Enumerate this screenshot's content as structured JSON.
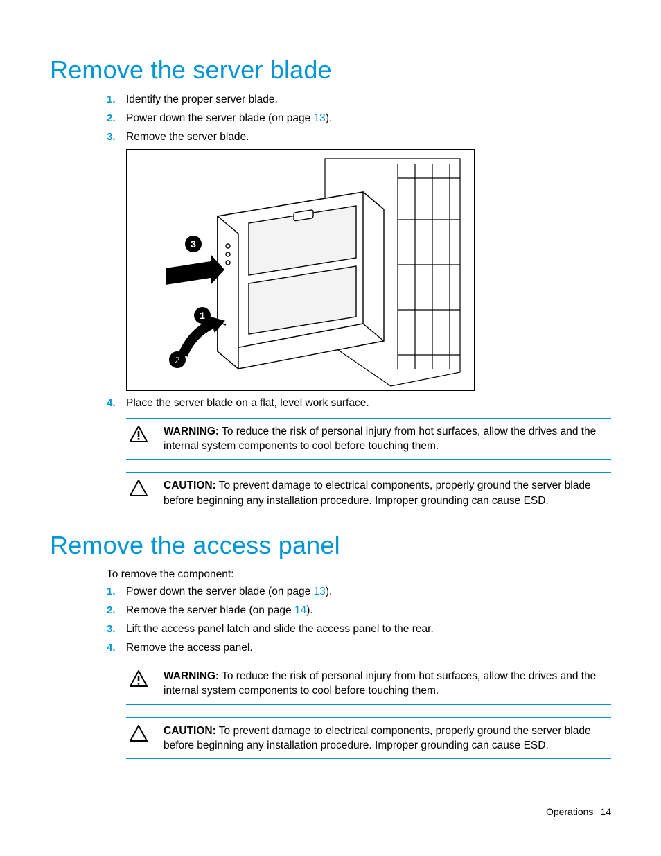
{
  "section1": {
    "heading": "Remove the server blade",
    "steps": [
      {
        "num": "1.",
        "text_before": "Identify the proper server blade.",
        "link": "",
        "text_after": ""
      },
      {
        "num": "2.",
        "text_before": "Power down the server blade (on page ",
        "link": "13",
        "text_after": ")."
      },
      {
        "num": "3.",
        "text_before": "Remove the server blade.",
        "link": "",
        "text_after": ""
      }
    ],
    "step4": {
      "num": "4.",
      "text": "Place the server blade on a flat, level work surface."
    },
    "warning": {
      "label": "WARNING:",
      "text": " To reduce the risk of personal injury from hot surfaces, allow the drives and the internal system components to cool before touching them."
    },
    "caution": {
      "label": "CAUTION:",
      "text": " To prevent damage to electrical components, properly ground the server blade before beginning any installation procedure. Improper grounding can cause ESD."
    },
    "figure_callouts": {
      "c1": "1",
      "c2": "2",
      "c3": "3"
    }
  },
  "section2": {
    "heading": "Remove the access panel",
    "intro": "To remove the component:",
    "steps": [
      {
        "num": "1.",
        "text_before": "Power down the server blade (on page ",
        "link": "13",
        "text_after": ")."
      },
      {
        "num": "2.",
        "text_before": "Remove the server blade (on page ",
        "link": "14",
        "text_after": ")."
      },
      {
        "num": "3.",
        "text_before": "Lift the access panel latch and slide the access panel to the rear.",
        "link": "",
        "text_after": ""
      },
      {
        "num": "4.",
        "text_before": "Remove the access panel.",
        "link": "",
        "text_after": ""
      }
    ],
    "warning": {
      "label": "WARNING:",
      "text": " To reduce the risk of personal injury from hot surfaces, allow the drives and the internal system components to cool before touching them."
    },
    "caution": {
      "label": "CAUTION:",
      "text": " To prevent damage to electrical components, properly ground the server blade before beginning any installation procedure. Improper grounding can cause ESD."
    }
  },
  "footer": {
    "section": "Operations",
    "page": "14"
  }
}
